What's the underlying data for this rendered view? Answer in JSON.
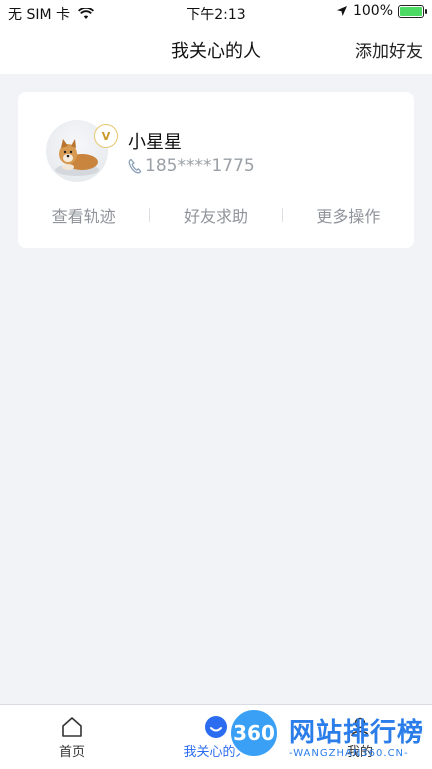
{
  "status_bar": {
    "carrier": "无 SIM 卡",
    "time": "下午2:13",
    "battery": "100%"
  },
  "header": {
    "title": "我关心的人",
    "add_label": "添加好友"
  },
  "contact": {
    "name": "小星星",
    "phone": "185****1775",
    "badge": "V",
    "actions": [
      "查看轨迹",
      "好友求助",
      "更多操作"
    ]
  },
  "tabbar": {
    "home": "首页",
    "care": "我关心的人",
    "mine": "我的"
  },
  "watermark": {
    "logo": "360",
    "title": "网站排行榜",
    "subtitle": "-WANGZHAN360.CN-"
  },
  "colors": {
    "accent": "#2b6cf0",
    "battery": "#4cd964"
  }
}
